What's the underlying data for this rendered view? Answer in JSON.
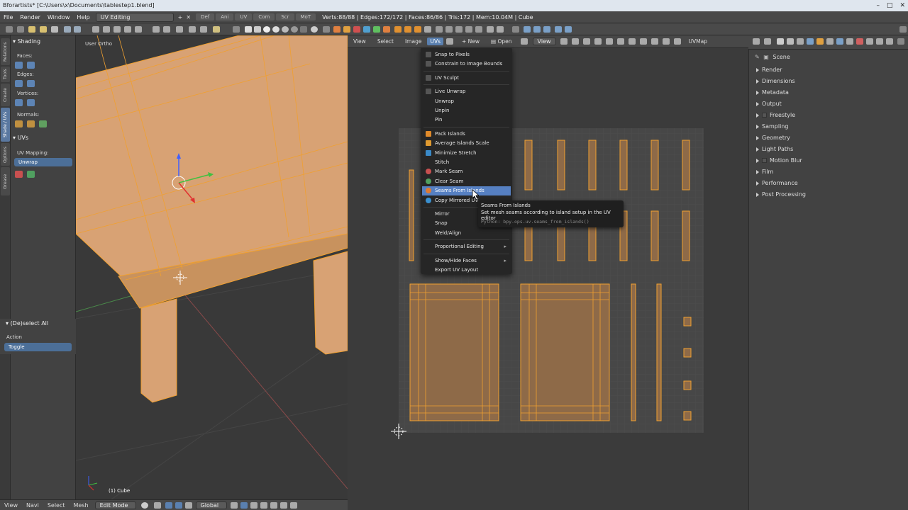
{
  "window": {
    "title": "Bforartists* [C:\\Users\\x\\Documents\\tablestep1.blend]",
    "controls": [
      "–",
      "□",
      "✕"
    ]
  },
  "topbar": {
    "menus": [
      "File",
      "Render",
      "Window",
      "Help"
    ],
    "layout": "UV Editing",
    "tabs": [
      "Def",
      "Ani",
      "UV",
      "Com",
      "Scr",
      "MoT"
    ],
    "stats": "Verts:88/88 | Edges:172/172 | Faces:86/86 | Tris:172 | Mem:10.04M | Cube"
  },
  "left_tabs": [
    "Relations",
    "Tools",
    "Create",
    "Shade / UVs",
    "Options",
    "Grease Pencil"
  ],
  "shelf": {
    "shading_header": "Shading",
    "faces_label": "Faces:",
    "edges_label": "Edges:",
    "vertices_label": "Vertices:",
    "normals_label": "Normals:",
    "uvs_header": "UVs",
    "uv_mapping_label": "UV Mapping:",
    "uv_mapping_value": "Unwrap"
  },
  "redo": {
    "header": "(De)select All",
    "action_label": "Action",
    "action_value": "Toggle"
  },
  "viewport": {
    "view_label": "User Ortho",
    "object_label": "(1) Cube",
    "menus": [
      "View",
      "Navi",
      "Select",
      "Mesh"
    ],
    "mode": "Edit Mode",
    "orientation": "Global"
  },
  "uv_editor": {
    "menus": [
      "View",
      "Select",
      "Image"
    ],
    "open_menu": "UVs",
    "new_label": "New",
    "open_label": "Open",
    "view_select": "View",
    "uvmap": "UVMap"
  },
  "uvs_menu": {
    "items": [
      {
        "label": "Snap to Pixels",
        "icon": "checkbox",
        "color": "#555555"
      },
      {
        "label": "Constrain to Image Bounds",
        "icon": "checkbox",
        "color": "#555555"
      },
      {
        "label": "UV Sculpt",
        "icon": "checkbox",
        "color": "#555555",
        "sep_before": true
      },
      {
        "label": "Live Unwrap",
        "icon": "checkbox",
        "color": "#555555",
        "sep_before": true
      },
      {
        "label": "Unwrap"
      },
      {
        "label": "Unpin"
      },
      {
        "label": "Pin"
      },
      {
        "label": "Pack Islands",
        "icon": "pack",
        "color": "#e08a2a",
        "sep_before": true
      },
      {
        "label": "Average Islands Scale",
        "icon": "average",
        "color": "#e09a30"
      },
      {
        "label": "Minimize Stretch",
        "icon": "stretch",
        "color": "#3a8ac8"
      },
      {
        "label": "Stitch"
      },
      {
        "label": "Mark Seam",
        "icon": "mark-seam",
        "color": "#c85050"
      },
      {
        "label": "Clear Seam",
        "icon": "clear-seam",
        "color": "#50a060"
      },
      {
        "label": "Seams From Islands",
        "icon": "seams-islands",
        "color": "#e07a30",
        "highlight": true
      },
      {
        "label": "Copy Mirrored UV",
        "icon": "copy-mirrored",
        "color": "#3a90d0"
      },
      {
        "label": "Mirror",
        "sep_before": true
      },
      {
        "label": "Snap"
      },
      {
        "label": "Weld/Align"
      },
      {
        "label": "Proportional Editing",
        "submenu": true,
        "sep_before": true
      },
      {
        "label": "Show/Hide Faces",
        "submenu": true,
        "sep_before": true
      },
      {
        "label": "Export UV Layout"
      }
    ]
  },
  "tooltip": {
    "title": "Seams From Islands",
    "description": "Set mesh seams according to island setup in the UV editor",
    "python": "Python: bpy.ops.uv.seams_from_islands()"
  },
  "properties": {
    "scene_label": "Scene",
    "panels": [
      "Render",
      "Dimensions",
      "Metadata",
      "Output",
      "Freestyle",
      "Sampling",
      "Geometry",
      "Light Paths",
      "Motion Blur",
      "Film",
      "Performance",
      "Post Processing"
    ]
  },
  "colors": {
    "accent": "#5680c2",
    "mesh_fill": "#d8a274",
    "mesh_edge": "#f0a030",
    "uv_fill": "#8e6a48"
  }
}
